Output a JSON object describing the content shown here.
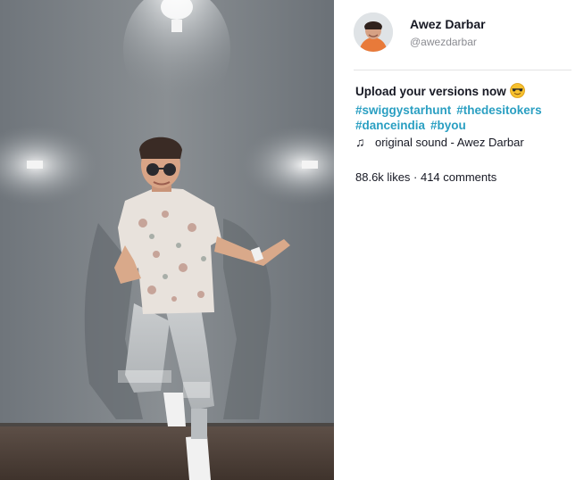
{
  "author": {
    "name": "Awez Darbar",
    "handle": "@awezdarbar",
    "avatar_icon": "avatar-photo"
  },
  "caption": {
    "text": "Upload your versions now",
    "emoji_icon": "sunglasses-emoji-icon",
    "hashtags": [
      "#swiggystarhunt",
      "#thedesitokers",
      "#danceindia",
      "#byou"
    ]
  },
  "sound": {
    "icon": "music-note-icon",
    "note_glyph": "♫",
    "label": "original sound - Awez Darbar"
  },
  "stats": {
    "text": "88.6k likes · 414 comments"
  },
  "colors": {
    "hashtag": "#2a9fc2",
    "text": "#161823",
    "muted": "#8a8b91"
  }
}
